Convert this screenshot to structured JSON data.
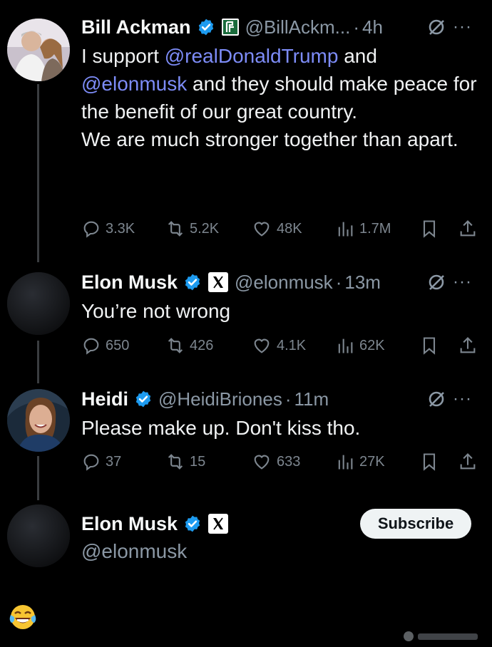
{
  "tweets": [
    {
      "name": "Bill Ackman",
      "handle": "@BillAckm...",
      "time": "4h",
      "text_prefix": "I support ",
      "mention1": "@realDonaldTrump",
      "text_mid": " and",
      "mention2": "@elonmusk",
      "text_rest": " and they should make peace for the benefit of our great country.",
      "text_para2": "We are much stronger together than apart.",
      "replies": "3.3K",
      "reposts": "5.2K",
      "likes": "48K",
      "views": "1.7M"
    },
    {
      "name": "Elon Musk",
      "handle": "@elonmusk",
      "time": "13m",
      "text": "You’re not wrong",
      "replies": "650",
      "reposts": "426",
      "likes": "4.1K",
      "views": "62K"
    },
    {
      "name": "Heidi",
      "handle": "@HeidiBriones",
      "time": "11m",
      "text": "Please make up. Don't kiss tho.",
      "replies": "37",
      "reposts": "15",
      "likes": "633",
      "views": "27K"
    }
  ],
  "profile_card": {
    "name": "Elon Musk",
    "handle": "@elonmusk",
    "subscribe_label": "Subscribe"
  },
  "icons": {
    "verified": "verified-badge-icon",
    "affiliate_ackman": "affiliate-badge-icon",
    "affiliate_x": "x-logo-icon",
    "grok": "grok-icon",
    "more": "more-icon",
    "reply": "reply-icon",
    "repost": "repost-icon",
    "like": "like-icon",
    "views": "views-icon",
    "bookmark": "bookmark-icon",
    "share": "share-icon",
    "emoji": "laughing-crying-emoji"
  },
  "colors": {
    "background": "#000000",
    "mention": "#7d8cf7",
    "verified": "#1d9bf0",
    "muted": "#8b98a5"
  }
}
